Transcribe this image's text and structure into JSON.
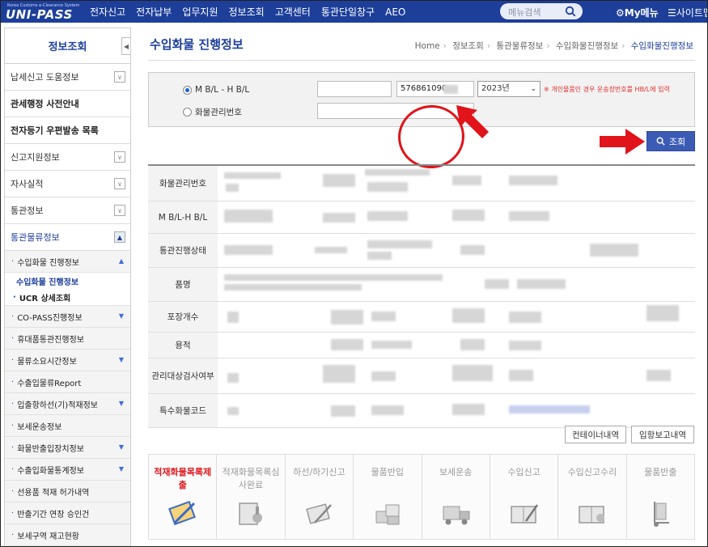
{
  "topbar": {
    "logo_small": "Korea Customs e-Clearance System",
    "logo_main": "UNI-PASS",
    "menu": [
      "전자신고",
      "전자납부",
      "업무지원",
      "정보조회",
      "고객센터",
      "통관단일창구",
      "AEO"
    ],
    "search_placeholder": "메뉴검색",
    "my_menu": "My메뉴",
    "sitemap": "사이트맵"
  },
  "sidebar": {
    "title": "정보조회",
    "items": [
      {
        "label": "납세신고 도움정보",
        "toggle": "v"
      },
      {
        "label": "관세행정 사전안내"
      },
      {
        "label": "전자등기 우편발송 목록"
      },
      {
        "label": "신고지원정보",
        "toggle": "v"
      },
      {
        "label": "자사실적",
        "toggle": "v"
      },
      {
        "label": "통관정보",
        "toggle": "v"
      },
      {
        "label": "통관물류정보",
        "toggle": "^"
      }
    ],
    "submenu": [
      {
        "label": "수입화물 진행정보",
        "arrow": "▲"
      },
      {
        "label": "수입화물 진행정보"
      },
      {
        "label": "UCR 상세조회"
      },
      {
        "label": "CO-PASS진행정보",
        "arrow": "▼"
      },
      {
        "label": "휴대품통관진행정보"
      },
      {
        "label": "물류소요시간정보",
        "arrow": "▼"
      },
      {
        "label": "수출입물류Report"
      },
      {
        "label": "입출항하선(기)적재정보",
        "arrow": "▼"
      },
      {
        "label": "보세운송정보"
      },
      {
        "label": "화물반출입장치정보",
        "arrow": "▼"
      },
      {
        "label": "수출입화물통계정보",
        "arrow": "▼"
      },
      {
        "label": "선용품 적재 허가내역"
      },
      {
        "label": "반출기간 연장 승인건"
      },
      {
        "label": "보세구역 재고현황"
      }
    ]
  },
  "main": {
    "title": "수입화물 진행정보",
    "breadcrumb": [
      "Home",
      "정보조회",
      "통관물류정보",
      "수입화물진행정보",
      "수입화물진행정보"
    ],
    "search": {
      "option_bl": "M B/L - H B/L",
      "option_cargo": "화물관리번호",
      "mbl_value": "",
      "hbl_value": "576861090",
      "year": "2023년",
      "note": "※ 개인물품인 경우 운송장번호를 HB/L에 입력",
      "cargo_value": "",
      "query_button": "조회"
    },
    "result_headers": [
      "화물관리번호",
      "M B/L-H B/L",
      "통관진행상태",
      "품명",
      "포장개수",
      "용적",
      "관리대상검사여부",
      "특수화물코드"
    ],
    "buttons": {
      "container": "컨테이너내역",
      "arrival": "입항보고내역"
    },
    "steps": [
      {
        "label": "적재화물목록제출",
        "active": true
      },
      {
        "label": "적재화물목록심사완료"
      },
      {
        "label": "하선/하기신고"
      },
      {
        "label": "물품반입"
      },
      {
        "label": "보세운송"
      },
      {
        "label": "수입신고"
      },
      {
        "label": "수입신고수리"
      },
      {
        "label": "물품반출"
      }
    ],
    "colors": {
      "brand": "#1d3f9a",
      "accent_red": "#e0141a",
      "button": "#3b5bb5"
    }
  }
}
